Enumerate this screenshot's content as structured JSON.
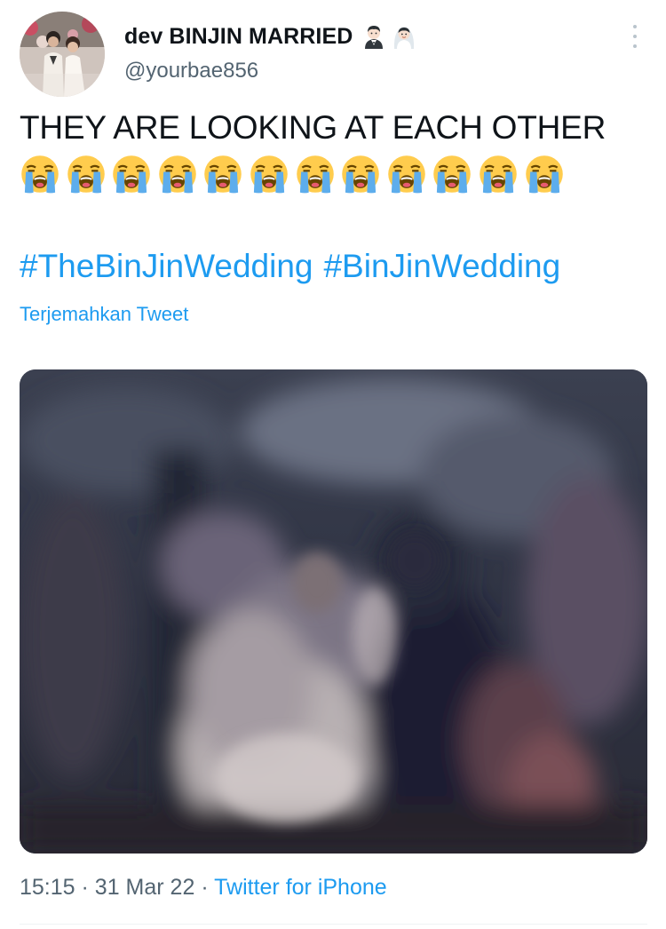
{
  "author": {
    "display_name": "dev BINJIN MARRIED",
    "name_emojis": [
      "groom-emoji",
      "bride-with-veil-emoji"
    ],
    "handle": "@yourbae856",
    "avatar": "profile-photo-couple-in-wedding-attire"
  },
  "menu": {
    "icon": "more-vertical-icon"
  },
  "tweet": {
    "text": "THEY ARE LOOKING AT EACH OTHER",
    "emojis": [
      "😭",
      "😭",
      "😭",
      "😭",
      "😭",
      "😭",
      "😭",
      "😭",
      "😭",
      "😭",
      "😭",
      "😭"
    ],
    "hashtags": [
      "#TheBinJinWedding",
      "#BinJinWedding"
    ],
    "translate_label": "Terjemahkan Tweet"
  },
  "media": {
    "description_icon": "blurry-wedding-photo"
  },
  "meta": {
    "time": "15:15",
    "separator": "·",
    "date": "31 Mar 22",
    "source": "Twitter for iPhone"
  },
  "colors": {
    "link": "#1d9bf0",
    "secondary": "#536471",
    "text": "#0f1419"
  }
}
